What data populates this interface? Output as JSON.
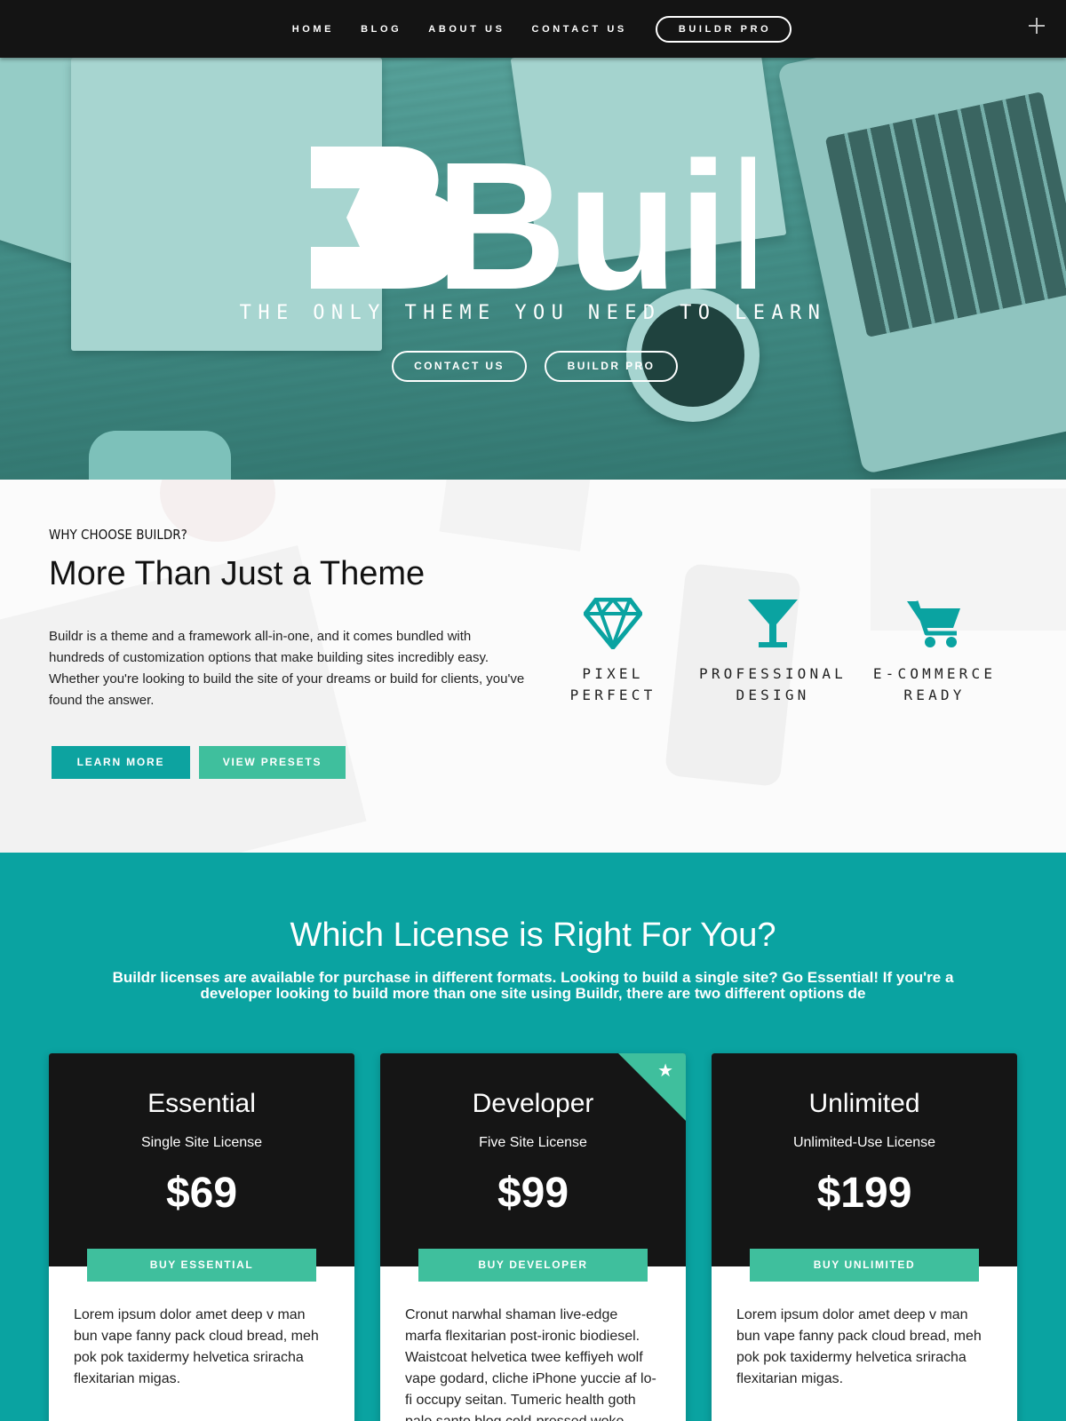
{
  "nav": {
    "links": [
      "HOME",
      "BLOG",
      "ABOUT US",
      "CONTACT US"
    ],
    "cta": "BUILDR PRO",
    "menu_icon": "plus-icon"
  },
  "hero": {
    "logo_text": "Buildr",
    "tagline": "THE ONLY THEME YOU NEED TO LEARN",
    "buttons": [
      "CONTACT US",
      "BUILDR PRO"
    ]
  },
  "why": {
    "eyebrow": "WHY CHOOSE BUILDR?",
    "title": "More Than Just a Theme",
    "body": "Buildr is a theme and a framework all-in-one, and it comes bundled with hundreds of customization options that make building sites incredibly easy. Whether you're looking to build the site of your dreams or build for clients, you've found the answer.",
    "buttons": [
      "LEARN MORE",
      "VIEW PRESETS"
    ],
    "features": [
      {
        "icon": "diamond-icon",
        "line1": "PIXEL",
        "line2": "PERFECT"
      },
      {
        "icon": "cocktail-icon",
        "line1": "PROFESSIONAL",
        "line2": "DESIGN"
      },
      {
        "icon": "cart-icon",
        "line1": "E-COMMERCE",
        "line2": "READY"
      }
    ]
  },
  "pricing": {
    "title": "Which License is Right For You?",
    "subtitle": "Buildr licenses are available for purchase in different formats. Looking to build a single site? Go Essential! If you're a developer looking to build more than one site using Buildr, there are two different options de",
    "plans": [
      {
        "name": "Essential",
        "sub": "Single Site License",
        "price": "$69",
        "button": "BUY ESSENTIAL",
        "desc": "Lorem ipsum dolor amet deep v man bun vape fanny pack cloud bread, meh pok pok taxidermy helvetica sriracha flexitarian migas."
      },
      {
        "name": "Developer",
        "sub": "Five Site License",
        "price": "$99",
        "button": "BUY DEVELOPER",
        "featured": true,
        "desc": "Cronut narwhal shaman live-edge marfa flexitarian post-ironic biodiesel. Waistcoat helvetica twee keffiyeh wolf vape godard, cliche iPhone yuccie af lo-fi occupy seitan. Tumeric health goth palo santo blog cold-pressed woke"
      },
      {
        "name": "Unlimited",
        "sub": "Unlimited-Use License",
        "price": "$199",
        "button": "BUY UNLIMITED",
        "desc": "Lorem ipsum dolor amet deep v man bun vape fanny pack cloud bread, meh pok pok taxidermy helvetica sriracha flexitarian migas."
      }
    ]
  },
  "colors": {
    "teal": "#0aa3a1",
    "mint": "#3fbf9d",
    "dark": "#141414"
  }
}
